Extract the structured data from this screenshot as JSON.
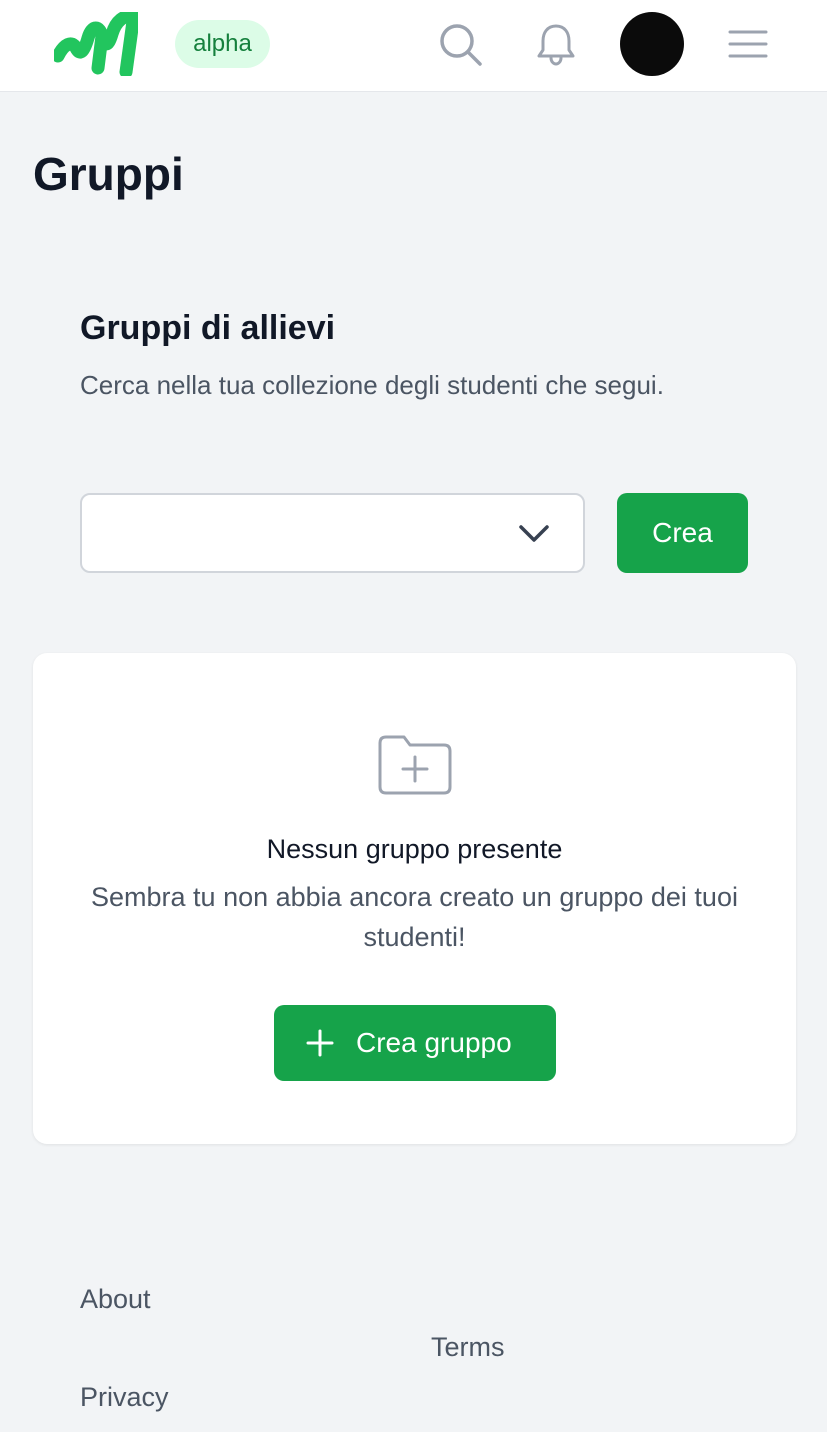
{
  "header": {
    "badge": "alpha",
    "logo_icon": "app-logo",
    "search_icon": "search-icon",
    "bell_icon": "bell-icon",
    "menu_icon": "hamburger-menu-icon",
    "brand_color": "#22c55e"
  },
  "page": {
    "title": "Gruppi"
  },
  "section": {
    "title": "Gruppi di allievi",
    "description": "Cerca nella tua collezione degli studenti che segui."
  },
  "select": {
    "value": "",
    "icon": "chevron-down-icon"
  },
  "actions": {
    "create_label": "Crea",
    "accent_color": "#16a34a"
  },
  "empty_state": {
    "icon": "folder-plus-icon",
    "title": "Nessun gruppo presente",
    "description": "Sembra tu non abbia ancora creato un gruppo dei tuoi studenti!",
    "button_label": "Crea gruppo",
    "button_icon": "plus-icon"
  },
  "footer": {
    "about": "About",
    "terms": "Terms",
    "privacy": "Privacy"
  }
}
